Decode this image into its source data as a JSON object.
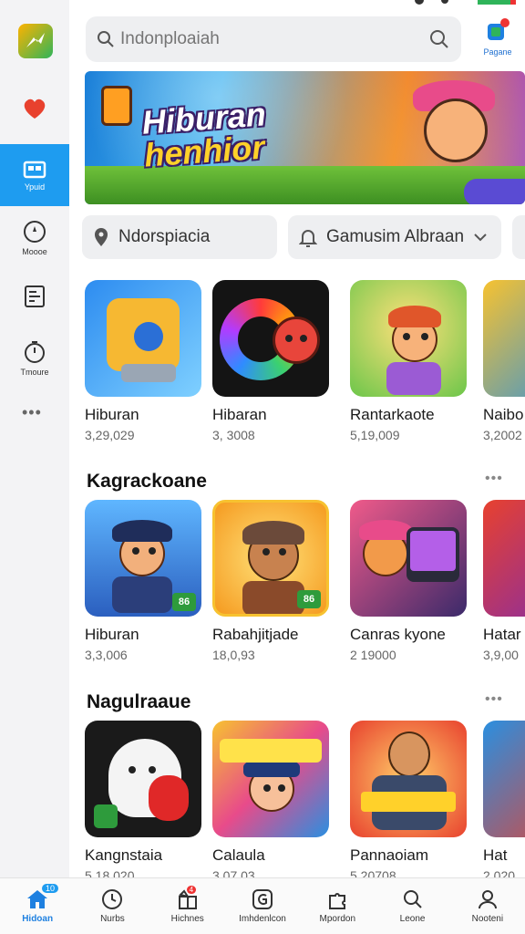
{
  "search": {
    "placeholder": "Indonploaiah"
  },
  "top_right": {
    "label": "Pagane"
  },
  "rail": {
    "items": [
      {
        "label": "Ypuid",
        "icon": "store-icon"
      },
      {
        "label": "Moooe",
        "icon": "compass-icon"
      },
      {
        "label": "",
        "icon": "library-icon"
      },
      {
        "label": "Tmoure",
        "icon": "timer-icon"
      }
    ]
  },
  "banner": {
    "line1": "Hiburan",
    "line2": "henhior"
  },
  "filters": [
    {
      "label": "Ndorspiacia",
      "icon": "location-pin-icon"
    },
    {
      "label": "Gamusim Albraan",
      "icon": "bell-icon"
    }
  ],
  "sections": [
    {
      "title": "",
      "tiles": [
        {
          "name": "Hiburan",
          "count": "3,29,029"
        },
        {
          "name": "Hibaran",
          "count": "3, 3008"
        },
        {
          "name": "Rantarkaote",
          "count": "5,19,009"
        },
        {
          "name": "Naibo",
          "count": "3,2002"
        }
      ]
    },
    {
      "title": "Kagrackoane",
      "tiles": [
        {
          "name": "Hiburan",
          "count": "3,3,006",
          "badge": "86"
        },
        {
          "name": "Rabahjitjade",
          "count": "18,0,93",
          "badge": "86"
        },
        {
          "name": "Canras kyone",
          "count": "2 19000"
        },
        {
          "name": "Hatar",
          "count": "3,9,00"
        }
      ]
    },
    {
      "title": "Nagulraaue",
      "tiles": [
        {
          "name": "Kangnstaia",
          "count": "5,18,020"
        },
        {
          "name": "Calaula",
          "count": "3,07,03"
        },
        {
          "name": "Pannaoiam",
          "count": "5,20708"
        },
        {
          "name": "Hat",
          "count": "2,020"
        }
      ]
    }
  ],
  "bottom_nav": [
    {
      "label": "Hidoan",
      "icon": "home-icon",
      "badge": "10"
    },
    {
      "label": "Nurbs",
      "icon": "clock-icon"
    },
    {
      "label": "Hichnes",
      "icon": "gift-icon",
      "badge": "4"
    },
    {
      "label": "Imhdenlcon",
      "icon": "g-icon"
    },
    {
      "label": "Mpordon",
      "icon": "puzzle-icon"
    },
    {
      "label": "Leone",
      "icon": "search-icon"
    },
    {
      "label": "Nooteni",
      "icon": "person-icon"
    }
  ],
  "colors": {
    "accent": "#1e9cf0",
    "badge_green": "#2e9b3c"
  }
}
